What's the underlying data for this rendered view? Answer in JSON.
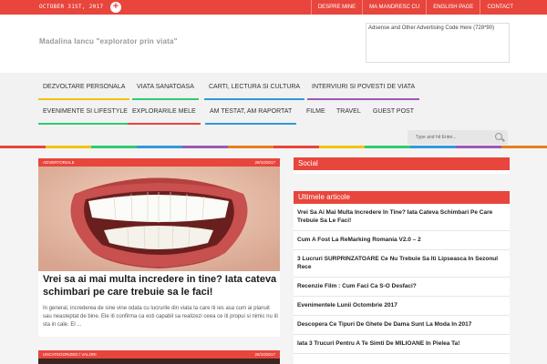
{
  "topbar": {
    "date": "OCTOBER 31ST, 2017",
    "plus_glyph": "+",
    "links": [
      "DESPRE MINE",
      "MA MANDRESC CU",
      "ENGLISH PAGE",
      "CONTACT"
    ]
  },
  "header": {
    "site_title": "Madalina Iancu \"explorator prin viata\"",
    "ad_text": "Adsense and Other Advertising Code Here (728*90)"
  },
  "nav": {
    "row1": [
      {
        "label": "DEZVOLTARE PERSONALA",
        "color": "#f1c40f"
      },
      {
        "label": "VIATA SANATOASA",
        "color": "#2ecc71"
      },
      {
        "label": "CARTI, LECTURA SI CULTURA",
        "color": "#3498db"
      },
      {
        "label": "INTERVIURI SI POVESTI DE VIATA",
        "color": "#9b59b6"
      }
    ],
    "row2": [
      {
        "label": "EVENIMENTE SI LIFESTYLE",
        "color": "#2ecc71"
      },
      {
        "label": "EXPLORARILE MELE",
        "color": "#e8453c"
      },
      {
        "label": "AM TESTAT, AM RAPORTAT",
        "color": "#3498db"
      },
      {
        "label": "FILME",
        "color": ""
      },
      {
        "label": "TRAVEL",
        "color": ""
      },
      {
        "label": "GUEST POST",
        "color": ""
      }
    ]
  },
  "search": {
    "placeholder": "Type and hit Enter..."
  },
  "colors": {
    "accent": "#e8453c"
  },
  "post": {
    "category": "ADVERTORIALE",
    "date": "28/10/2017",
    "title": "Vrei sa ai mai multa incredere in tine? Iata cateva schimbari pe care trebuie sa le faci!",
    "excerpt": "In general, increderea de sine vine odata cu lucrurile din viata ta care iti ies asa cum ai planuit sau neasteptat de bine. Ele iti confirma ca esti capabil sa realizezi ceea ce iti propui si nimic nu iti sta in cale. El ..."
  },
  "post2": {
    "category": "UNCATEGORIZED / VALORI",
    "date": "26/10/2017"
  },
  "sidebar": {
    "social_title": "Social",
    "latest_title": "Ultimele articole",
    "latest": [
      "Vrei Sa Ai Mai Multa Incredere In Tine? Iata Cateva Schimbari Pe Care Trebuie Sa Le Faci!",
      "Cum A Fost La ReMarking Romania V2.0 – 2",
      "3 Lucruri SURPRINZATOARE Ce Nu Trebuie Sa Iti Lipseasca In Sezonul Rece",
      "Recenzie Film : Cum Faci Ca S-O Desfaci?",
      "Evenimentele Lunii Octombrie 2017",
      "Descopera Ce Tipuri De Ghete De Dama Sunt La Moda In 2017",
      "Iata 3 Trucuri Pentru A Te Simti De MILIOANE In Pielea Ta!"
    ]
  }
}
